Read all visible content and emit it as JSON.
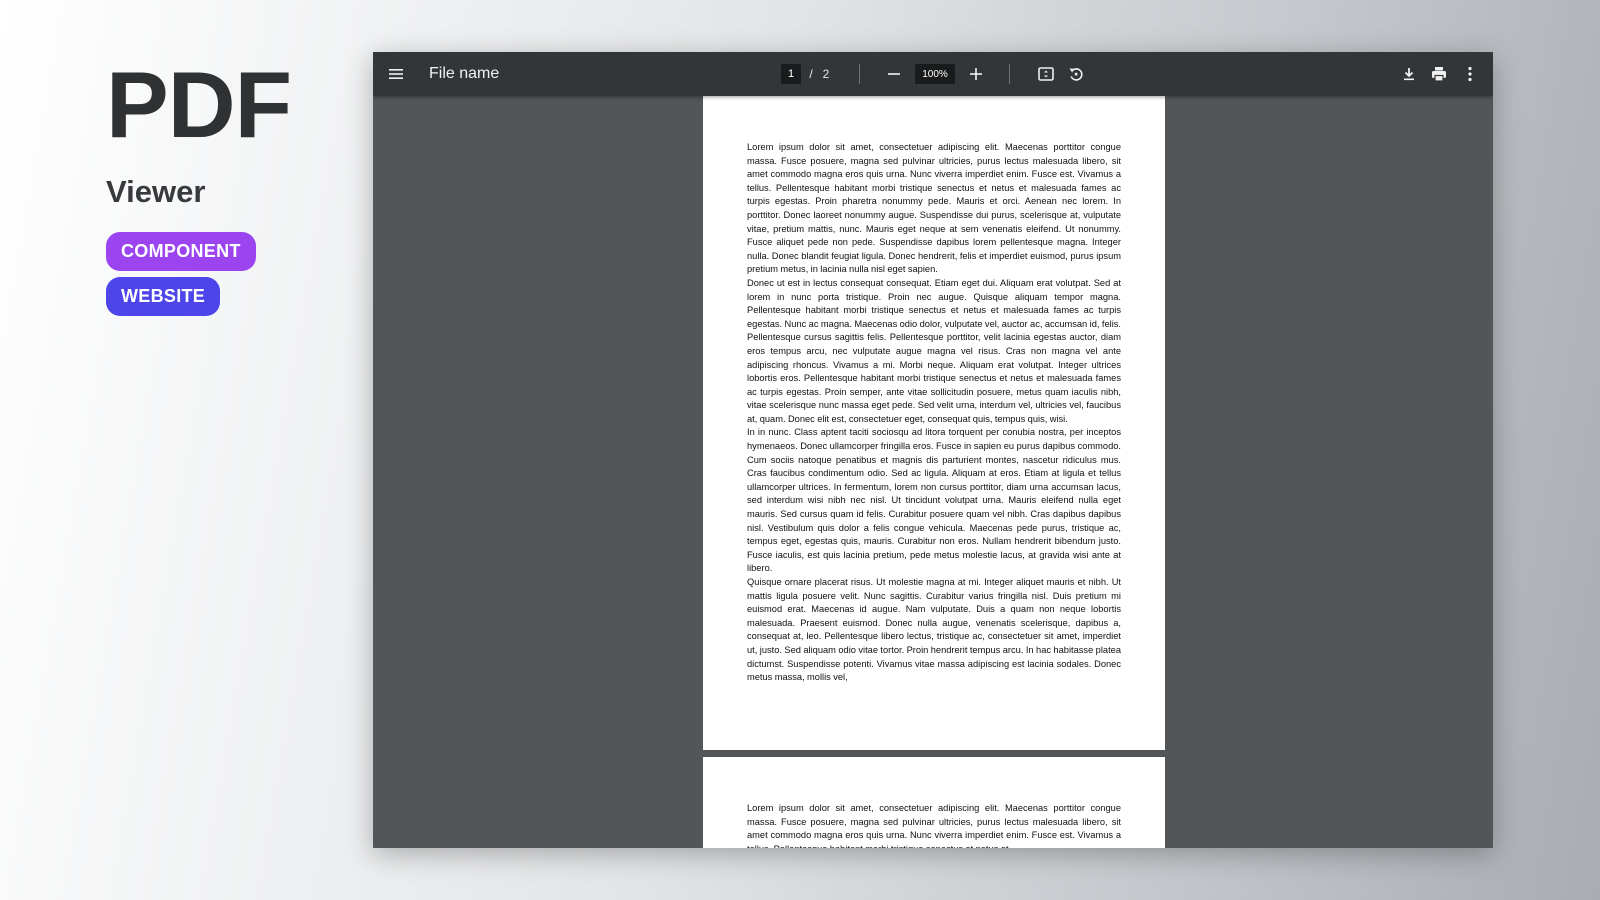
{
  "hero": {
    "title": "PDF",
    "subtitle": "Viewer",
    "tags": [
      "COMPONENT",
      "WEBSITE"
    ],
    "tag_colors": [
      "#9b44f0",
      "#4d45e9"
    ]
  },
  "toolbar": {
    "file_name": "File name",
    "current_page": "1",
    "page_separator": "/",
    "total_pages": "2",
    "zoom": "100%",
    "icons": [
      "menu-icon",
      "zoom-out-icon",
      "zoom-in-icon",
      "fit-page-icon",
      "rotate-icon",
      "download-icon",
      "print-icon",
      "more-vert-icon"
    ],
    "background_color": "#323639"
  },
  "document": {
    "page1_paragraphs": [
      "Lorem ipsum dolor sit amet, consectetuer adipiscing elit. Maecenas porttitor congue massa. Fusce posuere, magna sed pulvinar ultricies, purus lectus malesuada libero, sit amet commodo magna eros quis urna. Nunc viverra imperdiet enim. Fusce est. Vivamus a tellus. Pellentesque habitant morbi tristique senectus et netus et malesuada fames ac turpis egestas. Proin pharetra nonummy pede. Mauris et orci. Aenean nec lorem. In porttitor. Donec laoreet nonummy augue. Suspendisse dui purus, scelerisque at, vulputate vitae, pretium mattis, nunc. Mauris eget neque at sem venenatis eleifend. Ut nonummy. Fusce aliquet pede non pede. Suspendisse dapibus lorem pellentesque magna. Integer nulla. Donec blandit feugiat ligula. Donec hendrerit, felis et imperdiet euismod, purus ipsum pretium metus, in lacinia nulla nisl eget sapien.",
      "Donec ut est in lectus consequat consequat. Etiam eget dui. Aliquam erat volutpat. Sed at lorem in nunc porta tristique. Proin nec augue. Quisque aliquam tempor magna. Pellentesque habitant morbi tristique senectus et netus et malesuada fames ac turpis egestas. Nunc ac magna. Maecenas odio dolor, vulputate vel, auctor ac, accumsan id, felis. Pellentesque cursus sagittis felis. Pellentesque porttitor, velit lacinia egestas auctor, diam eros tempus arcu, nec vulputate augue magna vel risus. Cras non magna vel ante adipiscing rhoncus. Vivamus a mi. Morbi neque. Aliquam erat volutpat. Integer ultrices lobortis eros. Pellentesque habitant morbi tristique senectus et netus et malesuada fames ac turpis egestas. Proin semper, ante vitae sollicitudin posuere, metus quam iaculis nibh, vitae scelerisque nunc massa eget pede. Sed velit urna, interdum vel, ultricies vel, faucibus at, quam. Donec elit est, consectetuer eget, consequat quis, tempus quis, wisi.",
      "In in nunc. Class aptent taciti sociosqu ad litora torquent per conubia nostra, per inceptos hymenaeos. Donec ullamcorper fringilla eros. Fusce in sapien eu purus dapibus commodo. Cum sociis natoque penatibus et magnis dis parturient montes, nascetur ridiculus mus. Cras faucibus condimentum odio. Sed ac ligula. Aliquam at eros. Etiam at ligula et tellus ullamcorper ultrices. In fermentum, lorem non cursus porttitor, diam urna accumsan lacus, sed interdum wisi nibh nec nisl. Ut tincidunt volutpat urna. Mauris eleifend nulla eget mauris. Sed cursus quam id felis. Curabitur posuere quam vel nibh. Cras dapibus dapibus nisl. Vestibulum quis dolor a felis congue vehicula. Maecenas pede purus, tristique ac, tempus eget, egestas quis, mauris. Curabitur non eros. Nullam hendrerit bibendum justo. Fusce iaculis, est quis lacinia pretium, pede metus molestie lacus, at gravida wisi ante at libero.",
      "Quisque ornare placerat risus. Ut molestie magna at mi. Integer aliquet mauris et nibh. Ut mattis ligula posuere velit. Nunc sagittis. Curabitur varius fringilla nisl. Duis pretium mi euismod erat. Maecenas id augue. Nam vulputate. Duis a quam non neque lobortis malesuada. Praesent euismod. Donec nulla augue, venenatis scelerisque, dapibus a, consequat at, leo. Pellentesque libero lectus, tristique ac, consectetuer sit amet, imperdiet ut, justo. Sed aliquam odio vitae tortor. Proin hendrerit tempus arcu. In hac habitasse platea dictumst. Suspendisse potenti. Vivamus vitae massa adipiscing est lacinia sodales. Donec metus massa, mollis vel,"
    ],
    "page2_paragraphs": [
      "Lorem ipsum dolor sit amet, consectetuer adipiscing elit. Maecenas porttitor congue massa. Fusce posuere, magna sed pulvinar ultricies, purus lectus malesuada libero, sit amet commodo magna eros quis urna. Nunc viverra imperdiet enim. Fusce est. Vivamus a tellus. Pellentesque habitant morbi tristique senectus et netus et"
    ]
  }
}
